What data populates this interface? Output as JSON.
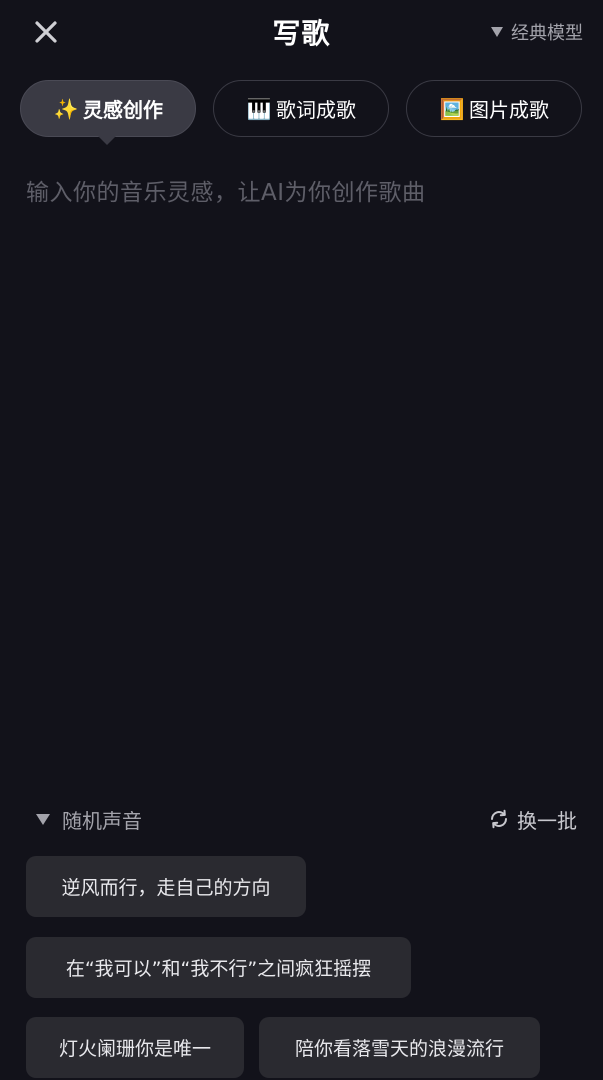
{
  "header": {
    "title": "写歌",
    "model_label": "经典模型"
  },
  "tabs": [
    {
      "label": "灵感创作",
      "emoji": "✨",
      "active": true
    },
    {
      "label": "歌词成歌",
      "emoji": "🎹",
      "active": false
    },
    {
      "label": "图片成歌",
      "emoji": "🖼️",
      "active": false
    }
  ],
  "prompt": {
    "value": "",
    "placeholder": "输入你的音乐灵感，让AI为你创作歌曲"
  },
  "voice": {
    "label": "随机声音",
    "refresh_label": "换一批"
  },
  "suggestions": [
    "逆风而行，走自己的方向",
    "在“我可以”和“我不行”之间疯狂摇摆",
    "灯火阑珊你是唯一",
    "陪你看落雪天的浪漫流行"
  ],
  "colors": {
    "background": "#12121a",
    "chip": "#2a2a30",
    "active_tab": "#3a3a44",
    "muted_text": "#a3a3ab",
    "placeholder": "#5e5e68"
  },
  "icons": {
    "close": "close-icon",
    "model_dropdown": "triangle-down-icon",
    "refresh": "refresh-icon"
  }
}
